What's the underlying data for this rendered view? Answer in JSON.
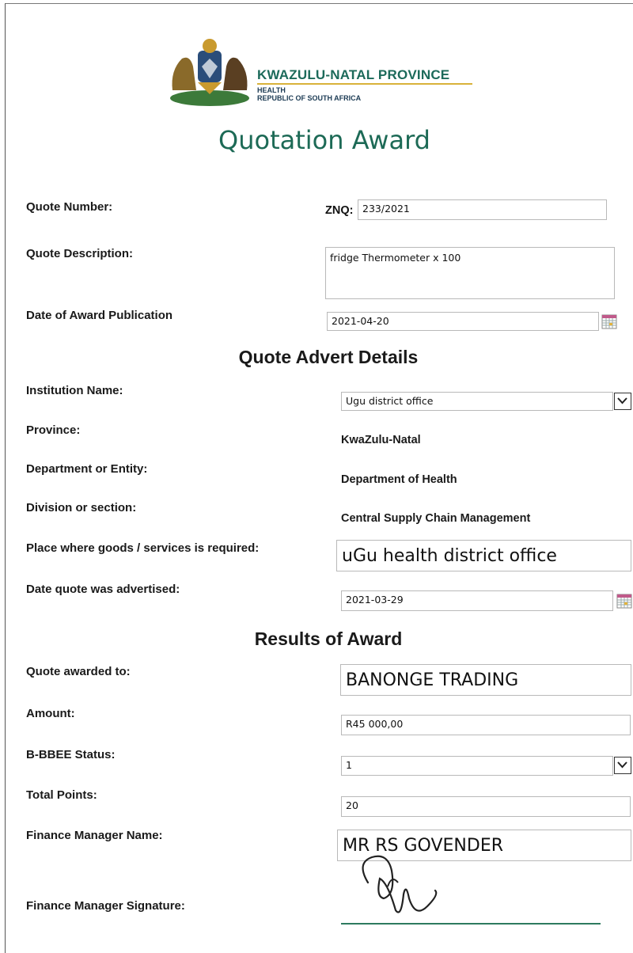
{
  "header": {
    "province_name": "KWAZULU-NATAL PROVINCE",
    "dept_line1": "HEALTH",
    "dept_line2": "REPUBLIC OF SOUTH AFRICA",
    "title": "Quotation Award"
  },
  "quote": {
    "number_label": "Quote Number:",
    "number_prefix": "ZNQ:",
    "number_value": "233/2021",
    "description_label": "Quote Description:",
    "description_value": "fridge Thermometer x 100",
    "publication_label": "Date of Award Publication",
    "publication_value": "2021-04-20"
  },
  "advert": {
    "heading": "Quote Advert Details",
    "institution_label": "Institution Name:",
    "institution_value": "Ugu district office",
    "province_label": "Province:",
    "province_value": "KwaZulu-Natal",
    "department_label": "Department or Entity:",
    "department_value": "Department of Health",
    "division_label": "Division or section:",
    "division_value": "Central Supply Chain Management",
    "place_label": "Place where goods /  services is required:",
    "place_value": "uGu health district office",
    "advertised_label": "Date quote was advertised:",
    "advertised_value": "2021-03-29"
  },
  "results": {
    "heading": "Results of Award",
    "awarded_label": "Quote awarded to:",
    "awarded_value": "BANONGE TRADING",
    "amount_label": "Amount:",
    "amount_value": "R45 000,00",
    "bbbee_label": "B-BBEE Status:",
    "bbbee_value": "1",
    "points_label": "Total Points:",
    "points_value": "20",
    "manager_label": "Finance Manager Name:",
    "manager_value": "MR RS GOVENDER",
    "signature_label": "Finance Manager Signature:"
  },
  "colors": {
    "title_green": "#1d6a56",
    "signature_line": "#2d7a5f"
  },
  "icons": [
    "coat-of-arms-logo",
    "calendar-icon",
    "chevron-down-icon",
    "signature-mark"
  ]
}
